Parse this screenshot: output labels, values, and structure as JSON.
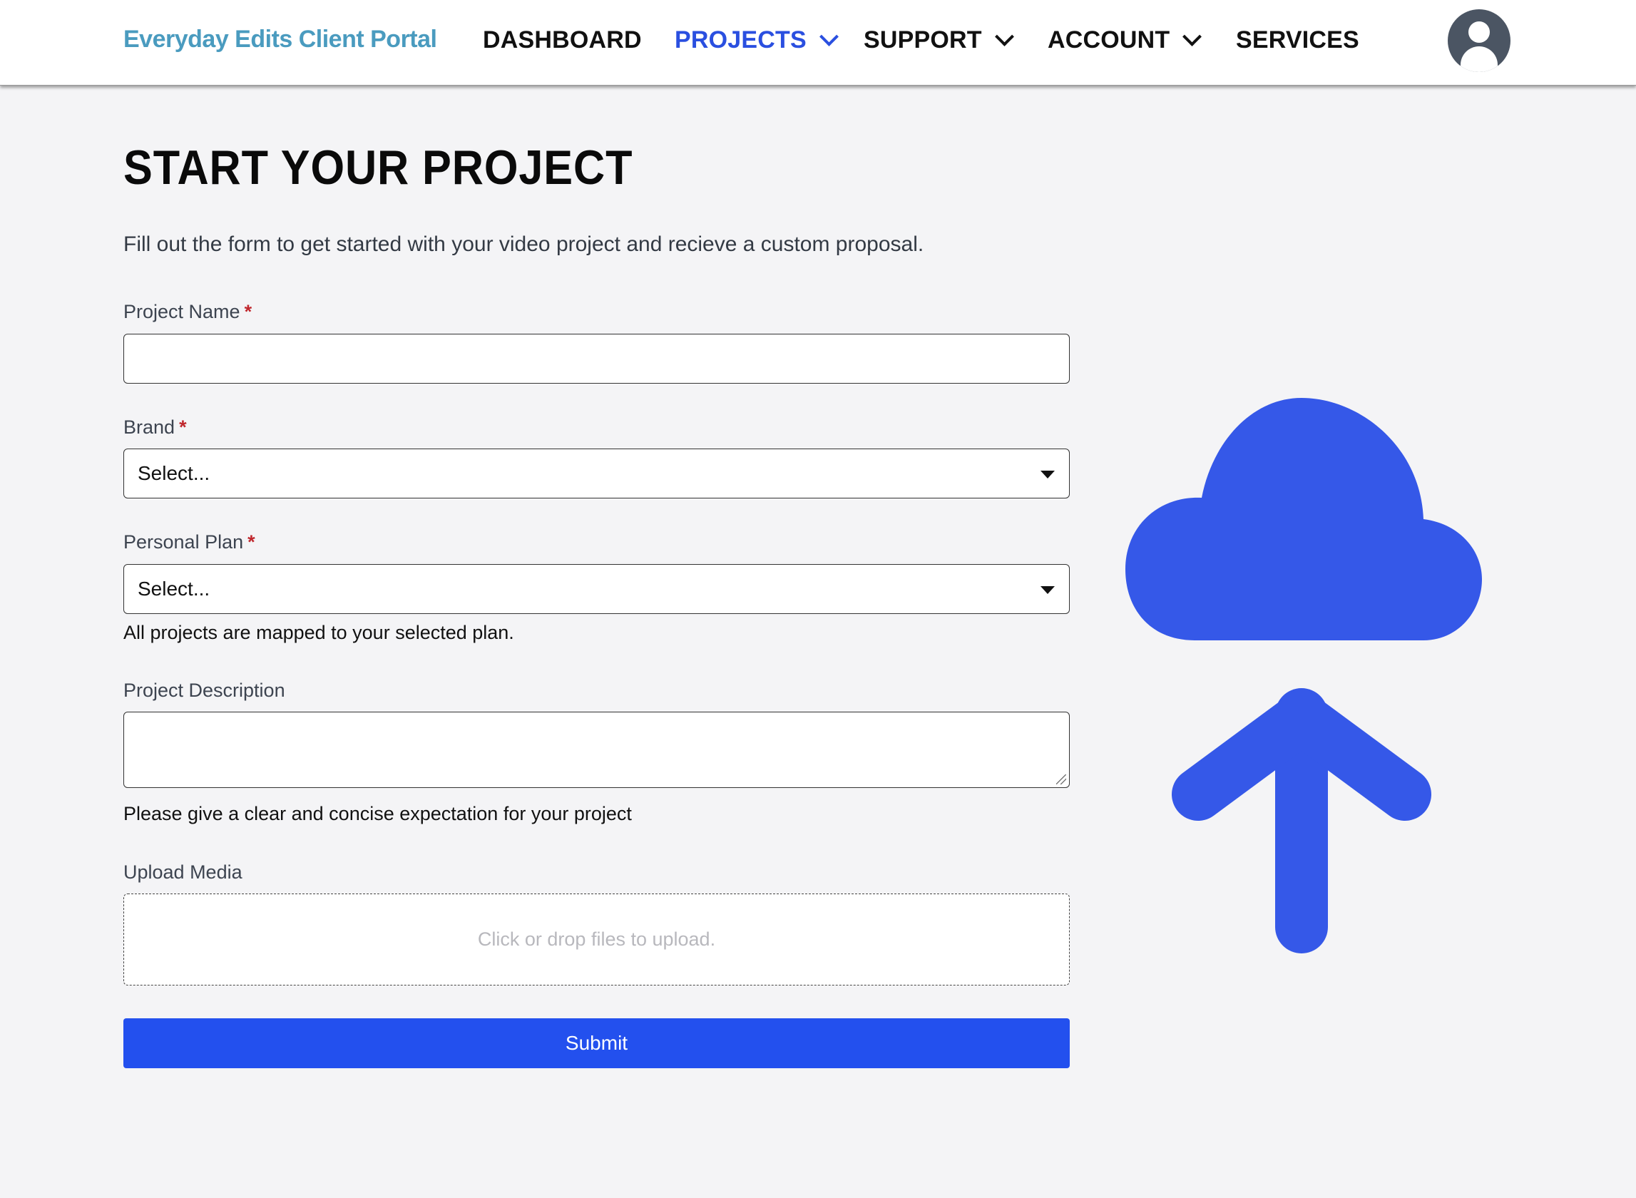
{
  "header": {
    "brand": "Everyday Edits Client Portal",
    "nav": [
      {
        "label": "DASHBOARD"
      },
      {
        "label": "PROJECTS"
      },
      {
        "label": "SUPPORT"
      },
      {
        "label": "ACCOUNT"
      },
      {
        "label": "SERVICES"
      }
    ],
    "active_nav": "PROJECTS",
    "avatar_icon": "user-circle-icon"
  },
  "page": {
    "title": "START YOUR PROJECT",
    "intro": "Fill out the form to get started with your video project and recieve a custom proposal."
  },
  "form": {
    "project_name": {
      "label": "Project Name",
      "required_mark": "*",
      "value": ""
    },
    "brand": {
      "label": "Brand",
      "required_mark": "*",
      "value": "Select..."
    },
    "personal_plan": {
      "label": "Personal Plan",
      "required_mark": "*",
      "value": "Select...",
      "help": "All projects are mapped to your selected plan."
    },
    "description": {
      "label": "Project Description",
      "value": "",
      "help": "Please give a clear and concise expectation for your project"
    },
    "upload": {
      "label": "Upload Media",
      "placeholder": "Click or drop files to upload."
    },
    "submit_label": "Submit"
  },
  "illustration": {
    "icon": "cloud-upload-icon",
    "color": "#3558e8"
  },
  "colors": {
    "brand": "#4a9bbf",
    "accent": "#2350ee",
    "required": "#c0272d",
    "background": "#f4f4f6"
  }
}
